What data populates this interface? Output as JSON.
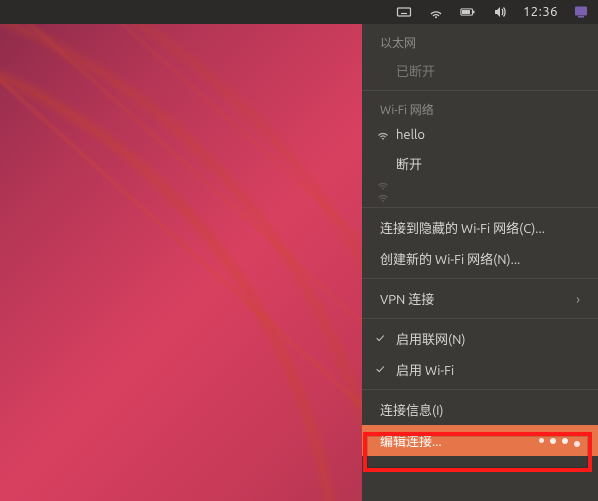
{
  "topbar": {
    "time": "12:36"
  },
  "menu": {
    "ethernet_header": "以太网",
    "ethernet_disconnected": "已断开",
    "wifi_header": "Wi-Fi 网络",
    "wifi_current": "hello",
    "wifi_disconnect": "断开",
    "connect_hidden": "连接到隐藏的 Wi-Fi 网络(C)...",
    "create_new_wifi": "创建新的 Wi-Fi 网络(N)...",
    "vpn": "VPN 连接",
    "enable_networking": "启用联网(N)",
    "enable_wifi": "启用 Wi-Fi",
    "connection_info": "连接信息(I)",
    "edit_connections": "编辑连接..."
  }
}
